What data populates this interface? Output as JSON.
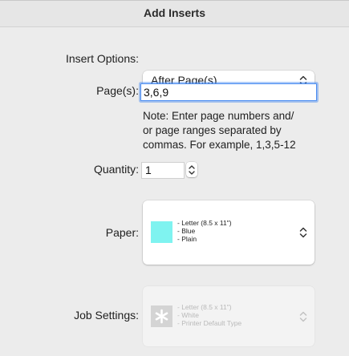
{
  "dialog": {
    "title": "Add Inserts"
  },
  "insert_options": {
    "label": "Insert Options:",
    "selected": "After Page(s)"
  },
  "pages": {
    "label": "Page(s):",
    "value": "3,6,9",
    "note_lines": [
      "Note: Enter page numbers and/",
      "or page ranges separated by",
      "commas.  For example, 1,3,5-12"
    ]
  },
  "quantity": {
    "label": "Quantity:",
    "value": "1"
  },
  "paper": {
    "label": "Paper:",
    "swatch_color": "#7ff3f0",
    "lines": [
      "- Letter (8.5 x 11\")",
      "- Blue",
      "- Plain"
    ]
  },
  "job_settings": {
    "label": "Job Settings:",
    "lines": [
      "- Letter (8.5 x 11\")",
      "- White",
      "- Printer Default Type"
    ]
  },
  "colors": {
    "focus_ring": "#4a8cf1",
    "background": "#ececec"
  },
  "icons": {
    "updown": "chevron-up-down-icon",
    "printer_default": "asterisk-icon"
  }
}
